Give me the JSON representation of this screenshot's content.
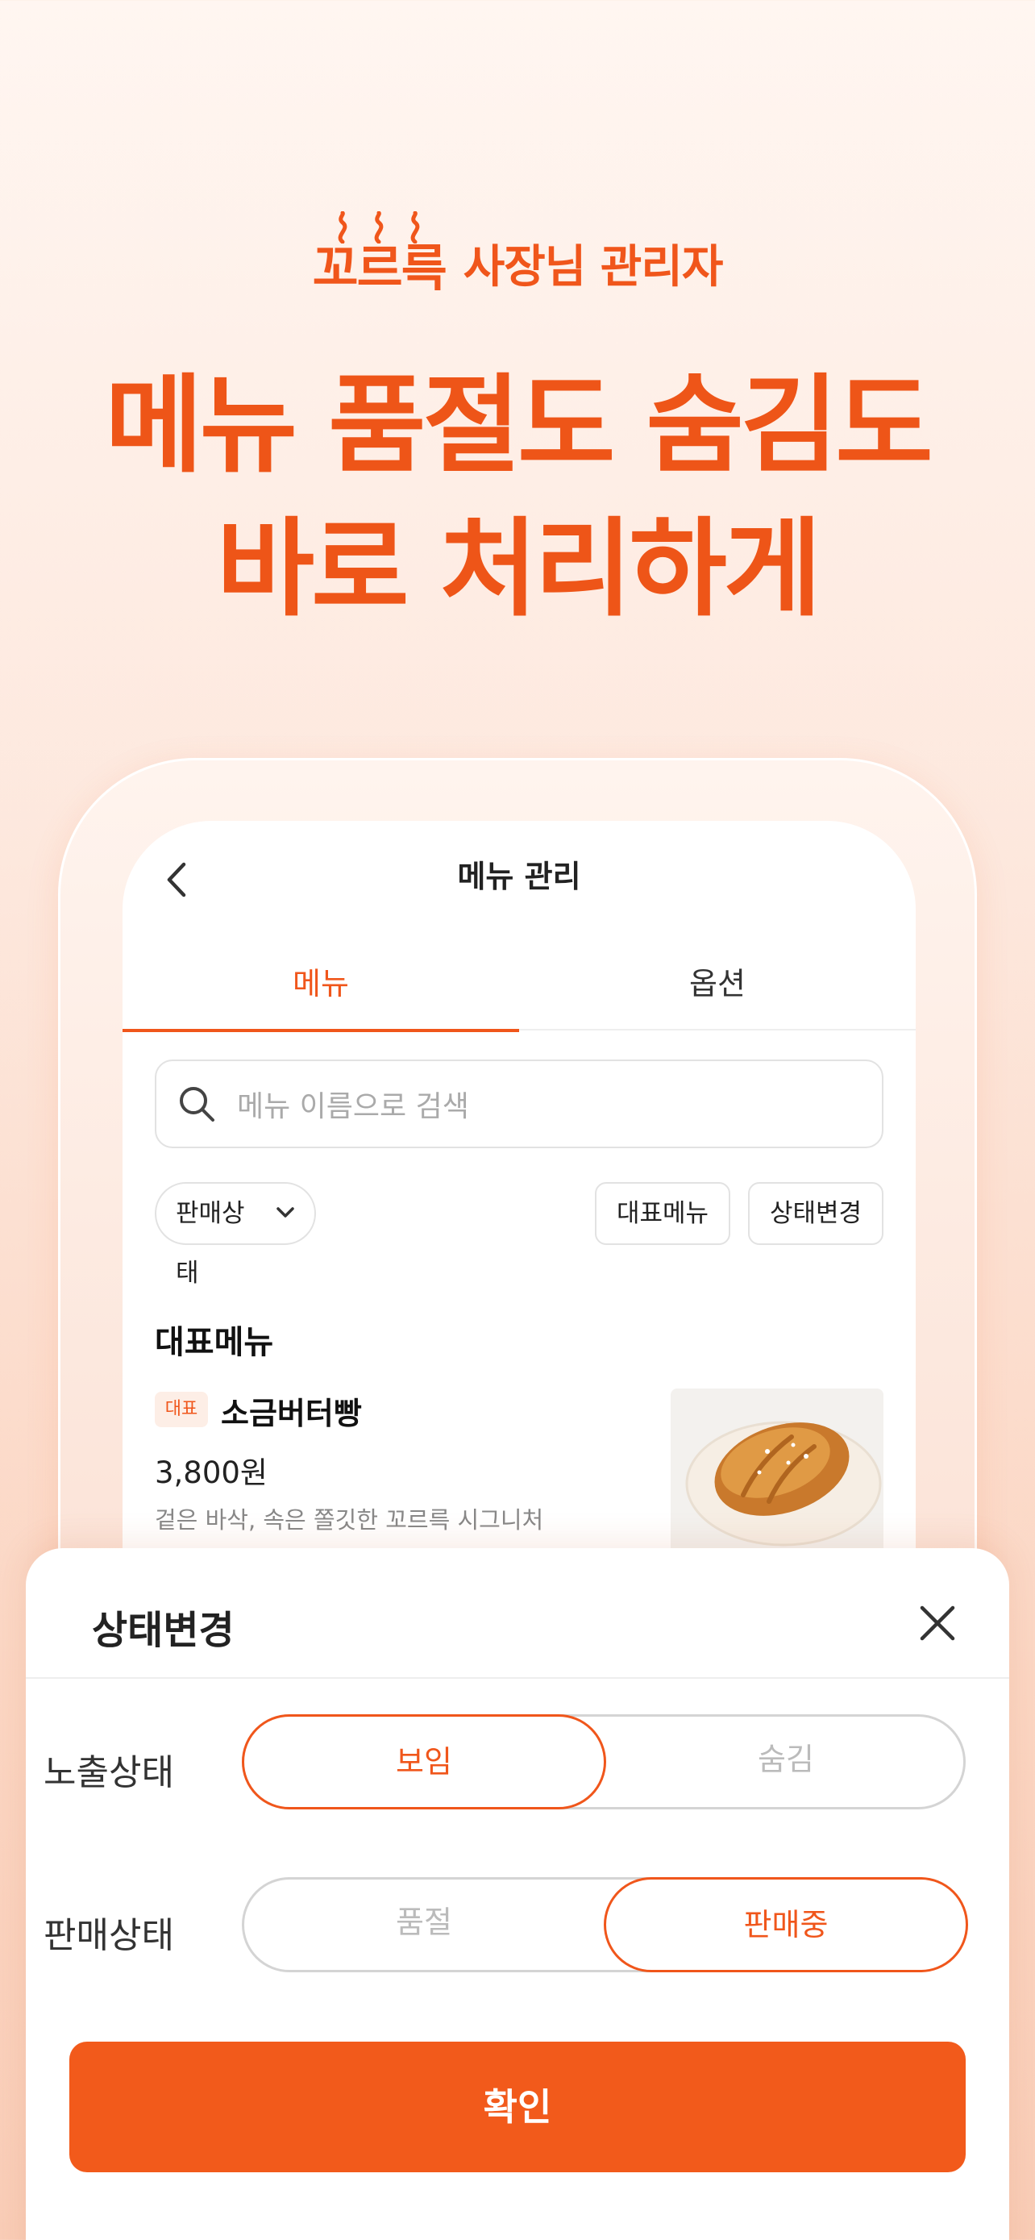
{
  "brand": {
    "logo_text": "꼬르륵",
    "logo_subtitle": "사장님 관리자"
  },
  "headline": {
    "line1": "메뉴 품절도 숨김도",
    "line2": "바로 처리하게"
  },
  "screen": {
    "nav_title": "메뉴 관리",
    "tabs": [
      {
        "label": "메뉴",
        "active": true
      },
      {
        "label": "옵션",
        "active": false
      }
    ],
    "search": {
      "placeholder": "메뉴 이름으로 검색"
    },
    "filters": {
      "status_dropdown": "판매상태",
      "rep_menu_button": "대표메뉴",
      "change_status_button": "상태변경"
    },
    "section_title": "대표메뉴",
    "item": {
      "badge": "대표",
      "name": "소금버터빵",
      "price": "3,800원",
      "description": "겉은 바삭, 속은 쫄깃한 꼬르륵 시그니처"
    }
  },
  "sheet": {
    "title": "상태변경",
    "exposure": {
      "label": "노출상태",
      "options": [
        "보임",
        "숨김"
      ],
      "selected": "보임"
    },
    "sales": {
      "label": "판매상태",
      "options": [
        "품절",
        "판매중"
      ],
      "selected": "판매중"
    },
    "confirm_label": "확인"
  },
  "colors": {
    "accent": "#f0561b",
    "button": "#f25a1b",
    "background": "#fde7dc"
  }
}
